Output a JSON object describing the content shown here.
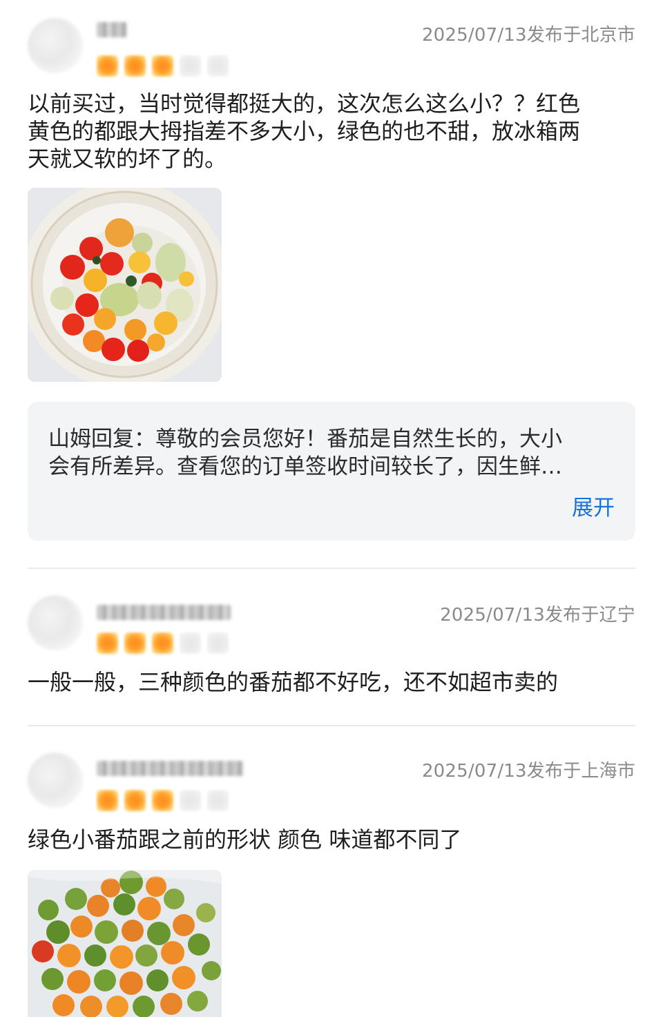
{
  "reviews": [
    {
      "meta": "2025/07/13发布于北京市",
      "rating": 3,
      "content_lines": [
        "以前买过，当时觉得都挺大的，这次怎么这么小？？红色",
        "黄色的都跟大拇指差不多大小，绿色的也不甜，放冰箱两",
        "天就又软的坏了的。"
      ],
      "reply": {
        "lines": [
          "山姆回复：尊敬的会员您好！番茄是自然生长的，大小",
          "会有所差异。查看您的订单签收时间较长了，因生鲜…"
        ],
        "expand_label": "展开"
      }
    },
    {
      "meta": "2025/07/13发布于辽宁",
      "rating": 3,
      "content_lines": [
        "一般一般，三种颜色的番茄都不好吃，还不如超市卖的"
      ]
    },
    {
      "meta": "2025/07/13发布于上海市",
      "rating": 3,
      "content_lines": [
        "绿色小番茄跟之前的形状 颜色 味道都不同了"
      ]
    }
  ],
  "colors": {
    "star_on": "#ff9a24",
    "star_off": "#ececec",
    "meta_text": "#8a8a8a",
    "expand_link": "#1773d9",
    "reply_bg": "#f3f4f6"
  }
}
